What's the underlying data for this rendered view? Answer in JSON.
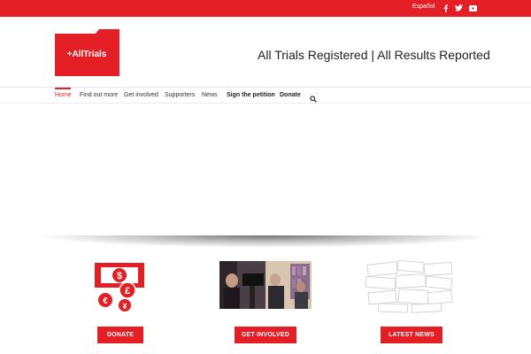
{
  "topbar": {
    "language": "Español",
    "social": [
      "facebook-icon",
      "twitter-icon",
      "youtube-icon"
    ],
    "color": "#e31e24"
  },
  "header": {
    "logo_text": "+AllTrials",
    "tagline": "All Trials Registered | All Results Reported"
  },
  "nav": {
    "items": [
      {
        "label": "Home",
        "active": true
      },
      {
        "label": "Find out more"
      },
      {
        "label": "Get involved"
      },
      {
        "label": "Supporters"
      },
      {
        "label": "News"
      },
      {
        "label": "Sign the petition",
        "bold": true
      },
      {
        "label": "Donate",
        "bold": true
      }
    ],
    "search_icon": "search-icon"
  },
  "features": [
    {
      "icon": "money-currency-icon",
      "button": "DONATE"
    },
    {
      "icon": "interview-photo",
      "button": "GET INVOLVED"
    },
    {
      "icon": "news-clippings-image",
      "button": "LATEST NEWS"
    }
  ]
}
